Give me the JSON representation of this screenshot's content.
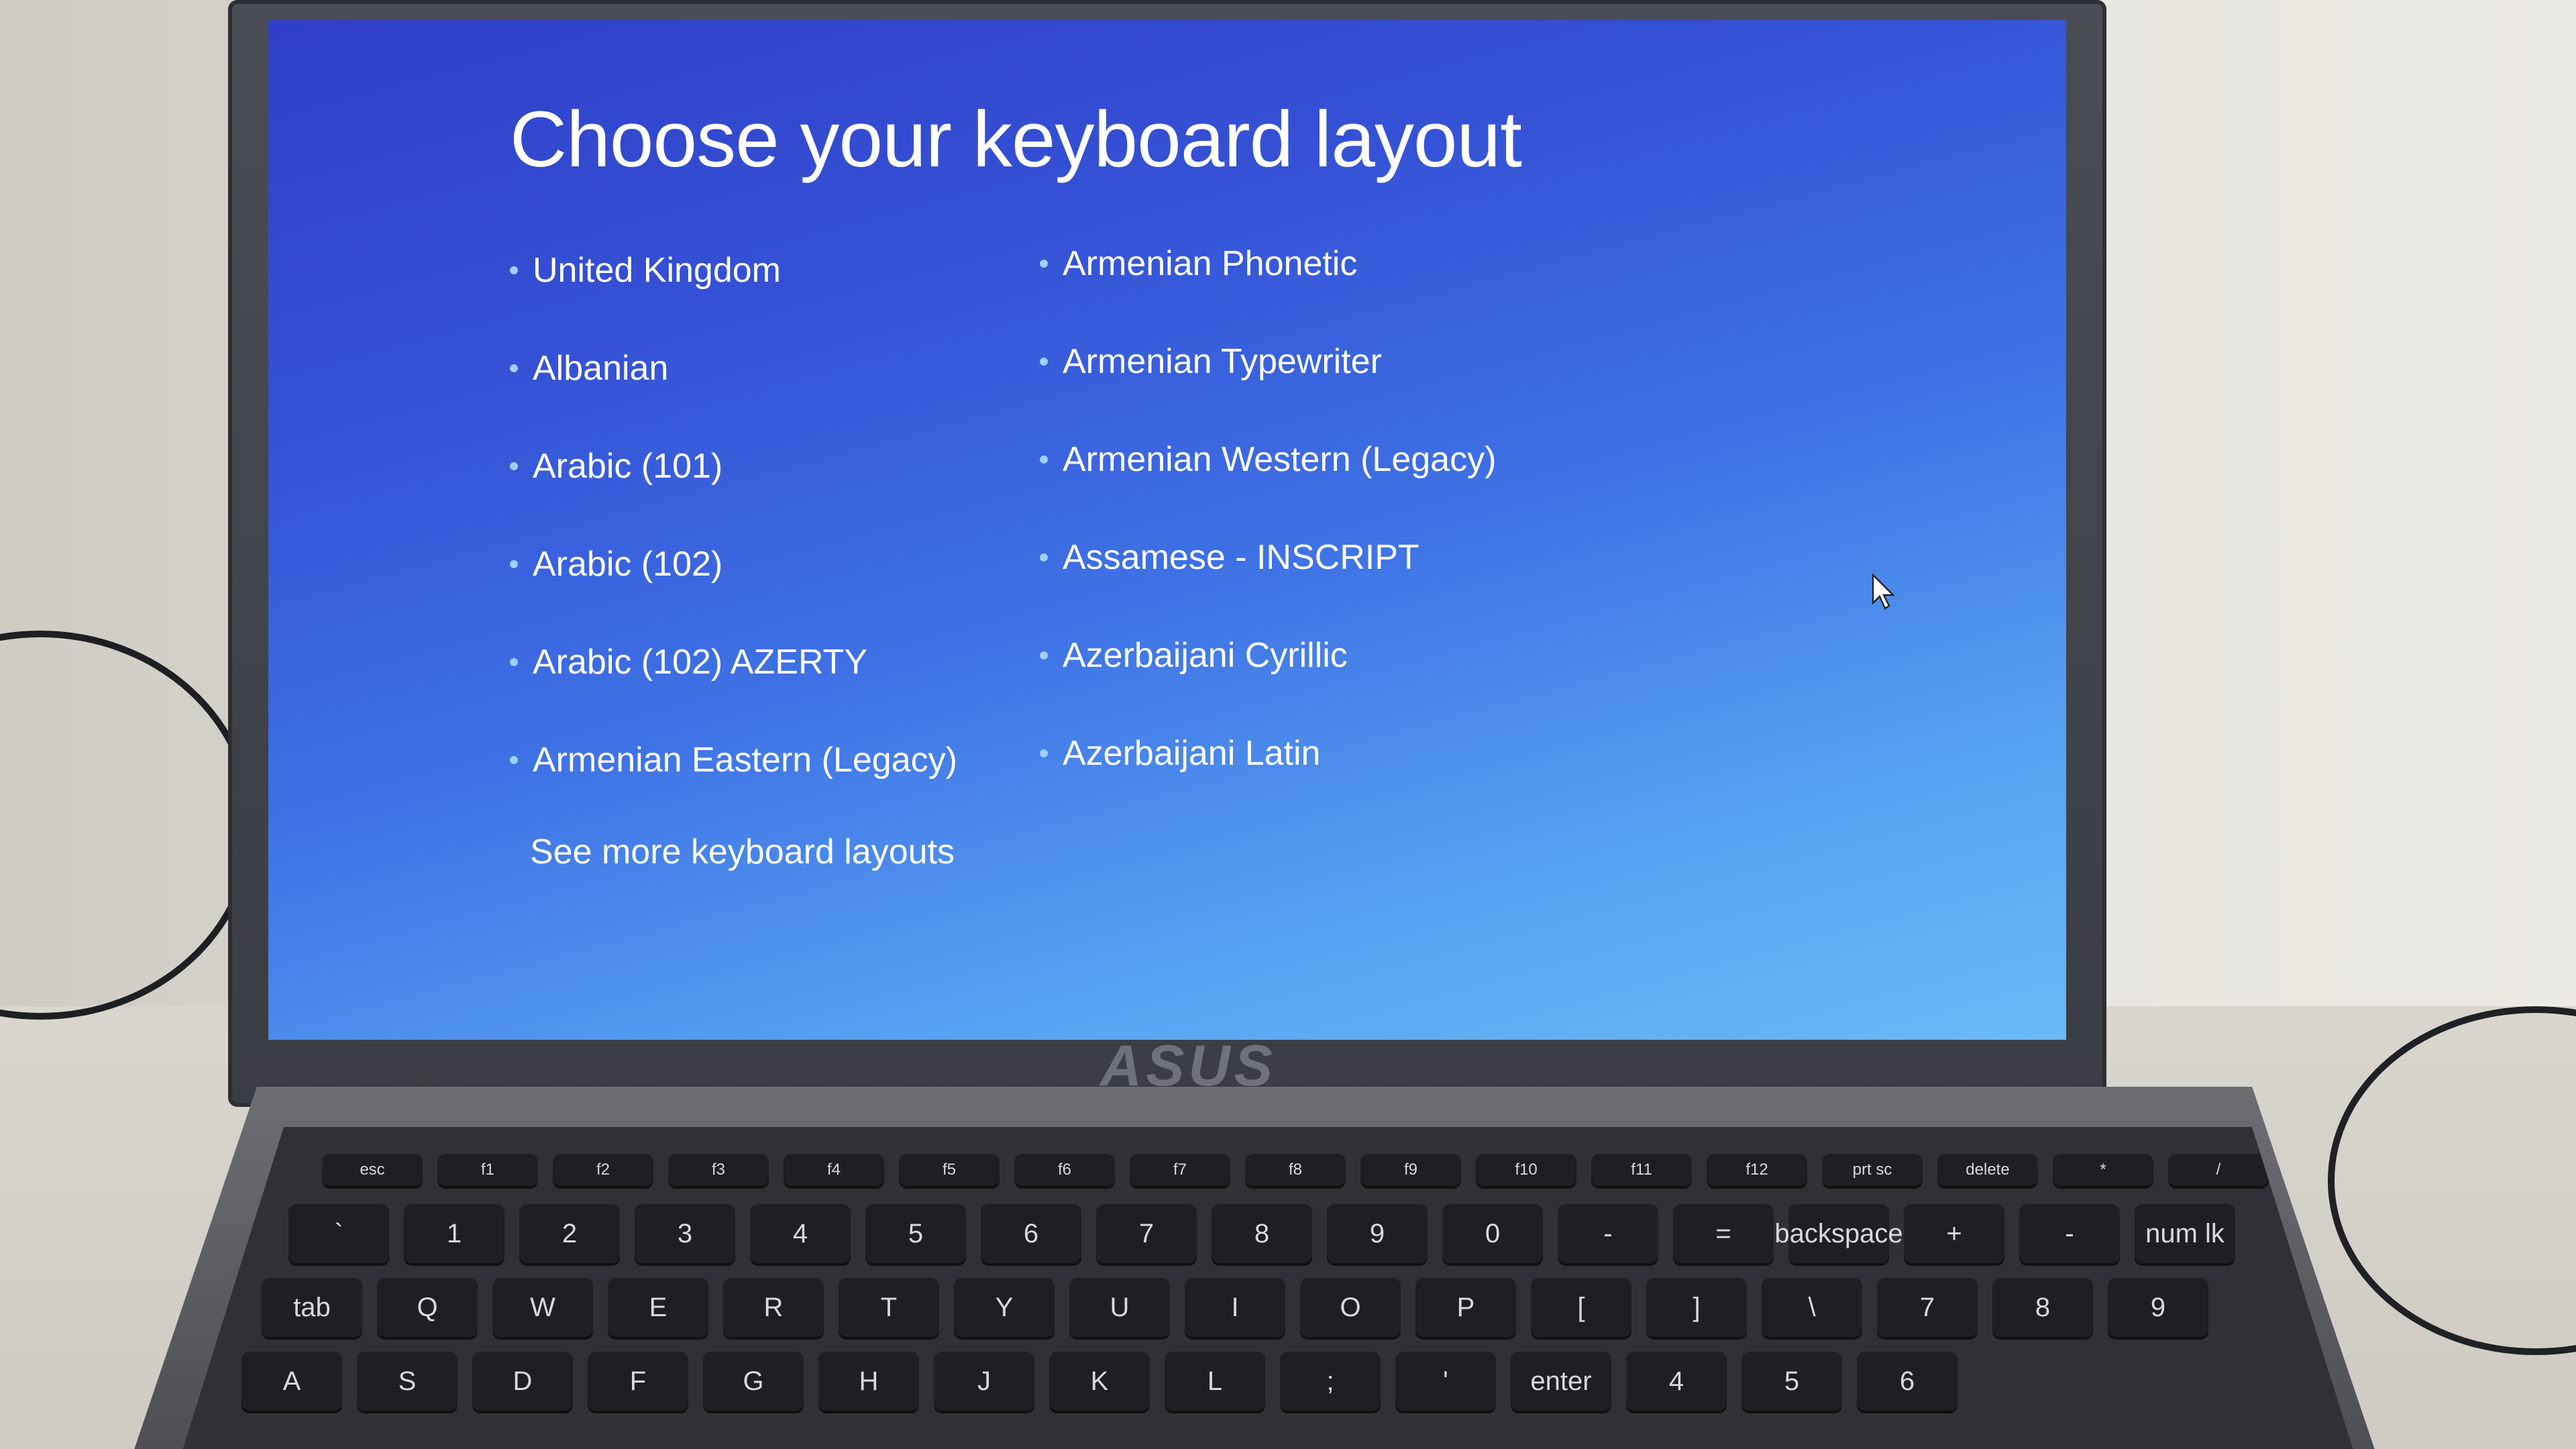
{
  "screen": {
    "title": "Choose your keyboard layout",
    "layouts_left": [
      "United Kingdom",
      "Albanian",
      "Arabic (101)",
      "Arabic (102)",
      "Arabic (102) AZERTY",
      "Armenian Eastern (Legacy)"
    ],
    "layouts_right": [
      "Armenian Phonetic",
      "Armenian Typewriter",
      "Armenian Western (Legacy)",
      "Assamese - INSCRIPT",
      "Azerbaijani Cyrillic",
      "Azerbaijani Latin"
    ],
    "see_more": "See more keyboard layouts"
  },
  "device": {
    "logo": "ASUS"
  },
  "keyboard": {
    "function_row": [
      "esc",
      "f1",
      "f2",
      "f3",
      "f4",
      "f5",
      "f6",
      "f7",
      "f8",
      "f9",
      "f10",
      "f11",
      "f12",
      "prt sc",
      "delete",
      "*",
      "/",
      "⏻"
    ],
    "number_row": [
      "`",
      "1",
      "2",
      "3",
      "4",
      "5",
      "6",
      "7",
      "8",
      "9",
      "0",
      "-",
      "=",
      "backspace",
      "+",
      "-",
      "num lk"
    ],
    "qwerty_row": [
      "tab",
      "Q",
      "W",
      "E",
      "R",
      "T",
      "Y",
      "U",
      "I",
      "O",
      "P",
      "[",
      "]",
      "\\",
      "7",
      "8",
      "9"
    ],
    "home_row": [
      "A",
      "S",
      "D",
      "F",
      "G",
      "H",
      "J",
      "K",
      "L",
      ";",
      "'",
      "enter",
      "4",
      "5",
      "6"
    ]
  },
  "colors": {
    "screen_top": "#2f3fc8",
    "screen_bottom": "#6ab9f6",
    "bullet": "#9fd0ff"
  }
}
